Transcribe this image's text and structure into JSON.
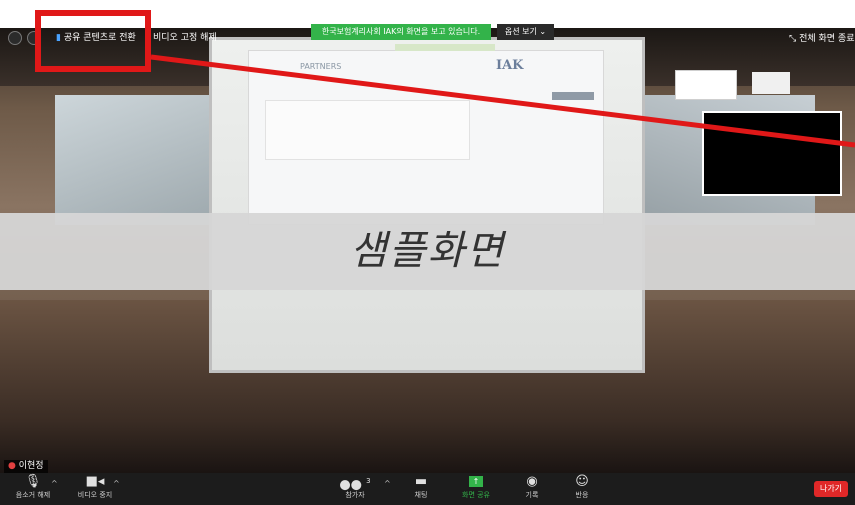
{
  "top_bar": {
    "switch_to_share": "공유 콘텐츠로 전환",
    "unpin_video": "비디오 고정 해제",
    "share_banner": "한국보험계리사회 IAK의 화면을 보고 있습니다.",
    "view_options": "옵션 보기",
    "fullscreen": "전체 화면 종료"
  },
  "overlay": {
    "text": "샘플화면"
  },
  "participant": {
    "name": "이현정"
  },
  "bottom_bar": {
    "mute_label": "음소거 해제",
    "video_label": "비디오 중지",
    "participants_label": "참가자",
    "participants_count": "3",
    "chat_label": "채팅",
    "share_label": "화면 공유",
    "record_label": "기록",
    "reactions_label": "반응",
    "leave_label": "나가기"
  },
  "colors": {
    "annotation": "#e01818",
    "share_green": "#33b34a",
    "leave_red": "#e02828"
  },
  "icons": {
    "mute": "mic-muted-icon",
    "video": "video-camera-icon",
    "participants": "people-icon",
    "chat": "chat-bubble-icon",
    "share": "share-screen-icon",
    "record": "record-icon",
    "reactions": "smiley-icon"
  }
}
